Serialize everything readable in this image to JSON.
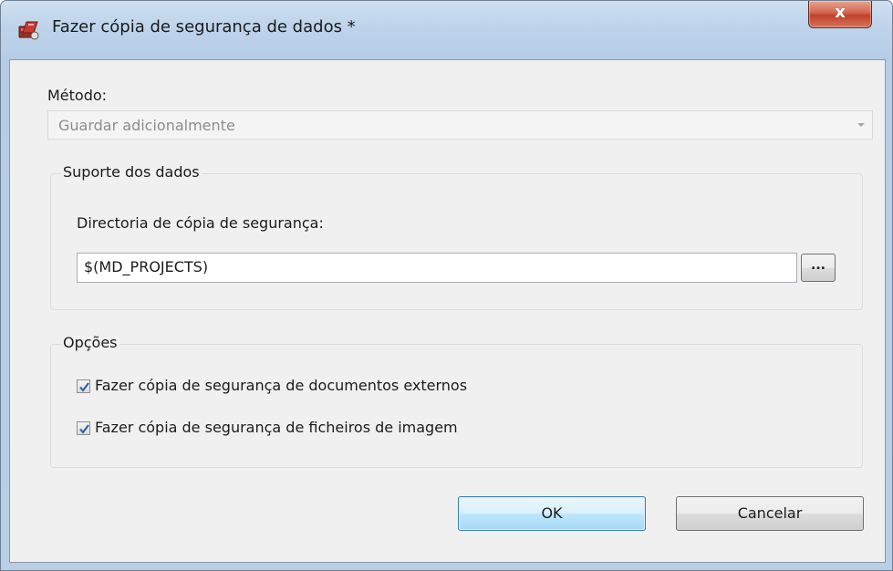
{
  "window": {
    "title": "Fazer cópia de segurança de dados *",
    "close_label": "x",
    "app_icon": "backup-app-icon"
  },
  "method": {
    "label": "Método:",
    "value": "Guardar adicionalmente",
    "enabled": false
  },
  "data_support": {
    "group_title": "Suporte dos dados",
    "directory_label": "Directoria de cópia de segurança:",
    "directory_value": "$(MD_PROJECTS)",
    "browse_label": "..."
  },
  "options": {
    "group_title": "Opções",
    "items": [
      {
        "label": "Fazer cópia de segurança de documentos externos",
        "checked": true
      },
      {
        "label": "Fazer cópia de segurança de ficheiros de imagem",
        "checked": true
      }
    ]
  },
  "buttons": {
    "ok": "OK",
    "cancel": "Cancelar"
  },
  "colors": {
    "titlebar": "#bdd3ea",
    "close_button": "#c1412a",
    "dialog_background": "#f0f0f0",
    "default_button": "#bee6fd"
  }
}
